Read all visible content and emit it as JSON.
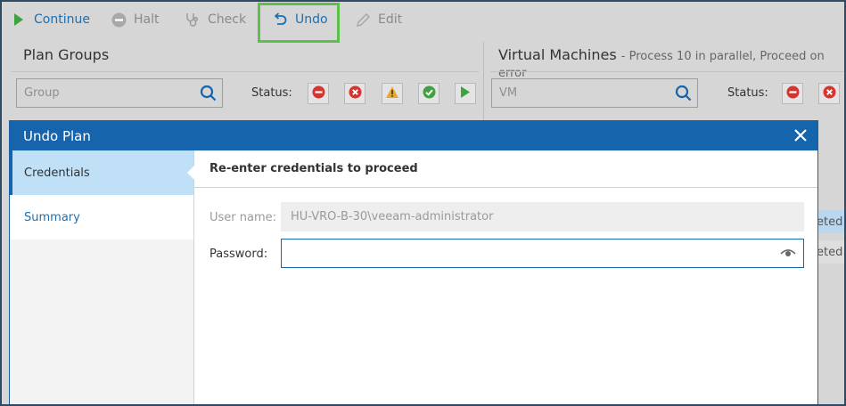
{
  "toolbar": {
    "continue_label": "Continue",
    "halt_label": "Halt",
    "check_label": "Check",
    "undo_label": "Undo",
    "edit_label": "Edit"
  },
  "left_pane": {
    "title": "Plan Groups",
    "search_placeholder": "Group",
    "status_label": "Status:"
  },
  "right_pane": {
    "title": "Virtual Machines",
    "subtitle": "- Process 10 in parallel, Proceed on error",
    "search_placeholder": "VM",
    "status_label": "Status:",
    "rows": [
      "eted",
      "eted"
    ]
  },
  "modal": {
    "title": "Undo Plan",
    "nav": [
      {
        "label": "Credentials",
        "selected": true
      },
      {
        "label": "Summary",
        "selected": false
      }
    ],
    "content_title": "Re-enter credentials to proceed",
    "username_label": "User name:",
    "username_value": "HU-VRO-B-30\\veeam-administrator",
    "password_label": "Password:",
    "password_value": ""
  },
  "colors": {
    "accent": "#1564ac",
    "highlight": "#5cc04a",
    "nav_selected": "#bfe0f7",
    "background": "#d6d6d6"
  },
  "icons": {
    "continue": "play-icon",
    "halt": "halt-icon",
    "check": "stethoscope-icon",
    "undo": "undo-icon",
    "edit": "pencil-icon",
    "search": "search-icon",
    "close": "close-icon",
    "eye": "eye-icon"
  }
}
